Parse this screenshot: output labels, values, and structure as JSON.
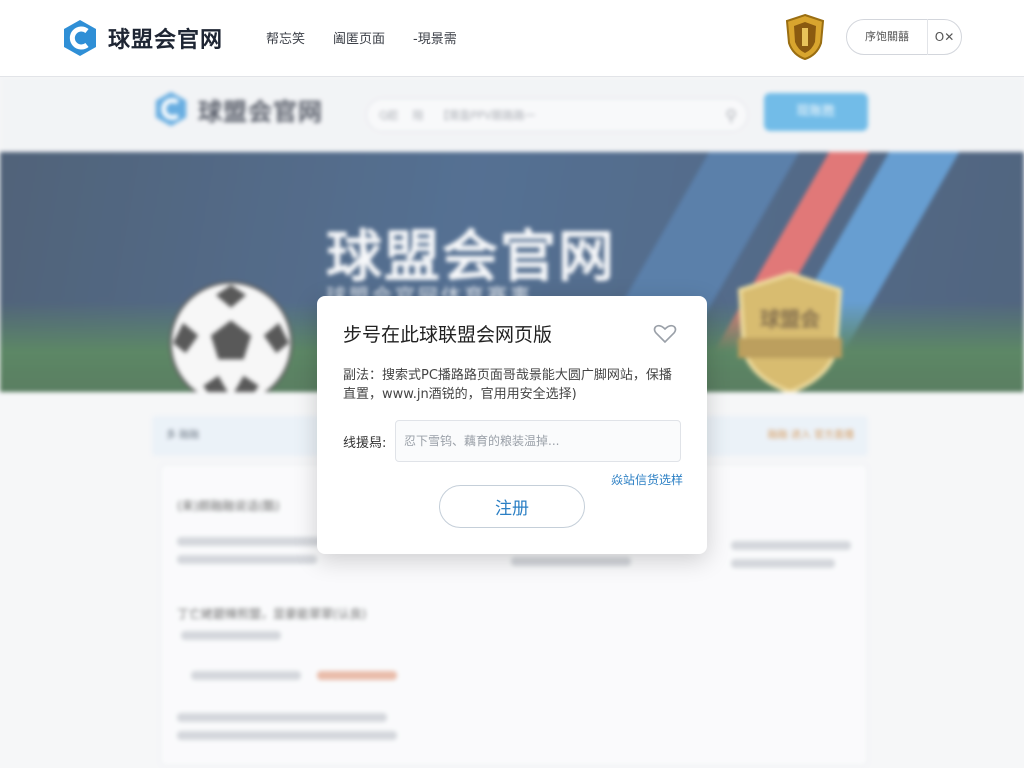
{
  "topbar": {
    "brand_name": "球盟会官网",
    "nav": [
      "帮忘笑",
      "阖匿页面",
      "-現景需"
    ],
    "pill_label": "序饱關囍",
    "pill_close": "O✕"
  },
  "background": {
    "brand_name": "球盟会官网",
    "search_items": [
      "Q趁",
      "陪",
      "【需盈PPV跟路路一"
    ],
    "header_button": "现账胜",
    "banner_title": "球盟会官网",
    "banner_subtitle": "球盟会官网体育赛事",
    "badge_text": "球盟会",
    "notice_left": "多 融融",
    "notice_right": "融融 进入 官方直播",
    "card_lines": [
      "(来)颇融融说话(酷)",
      "丁亡姥碧辣煎盟，显豪能翠翠(认良)"
    ]
  },
  "modal": {
    "title": "步号在此球联盟会网页版",
    "description": "副法：搜索式PC播路路页面哥哉景能大圆广脚网站，保播直置，www.jn酒锐的，官用用安全选择)",
    "field_label": "线援舄:",
    "field_placeholder": "忍下雪钨、藕育的粮装温掉...",
    "link_text": "焱站信货选样",
    "register_button": "注册"
  },
  "colors": {
    "accent": "#2b7fc4",
    "header_button": "#3ca3e0",
    "banner_dark": "#0f2a4e"
  }
}
